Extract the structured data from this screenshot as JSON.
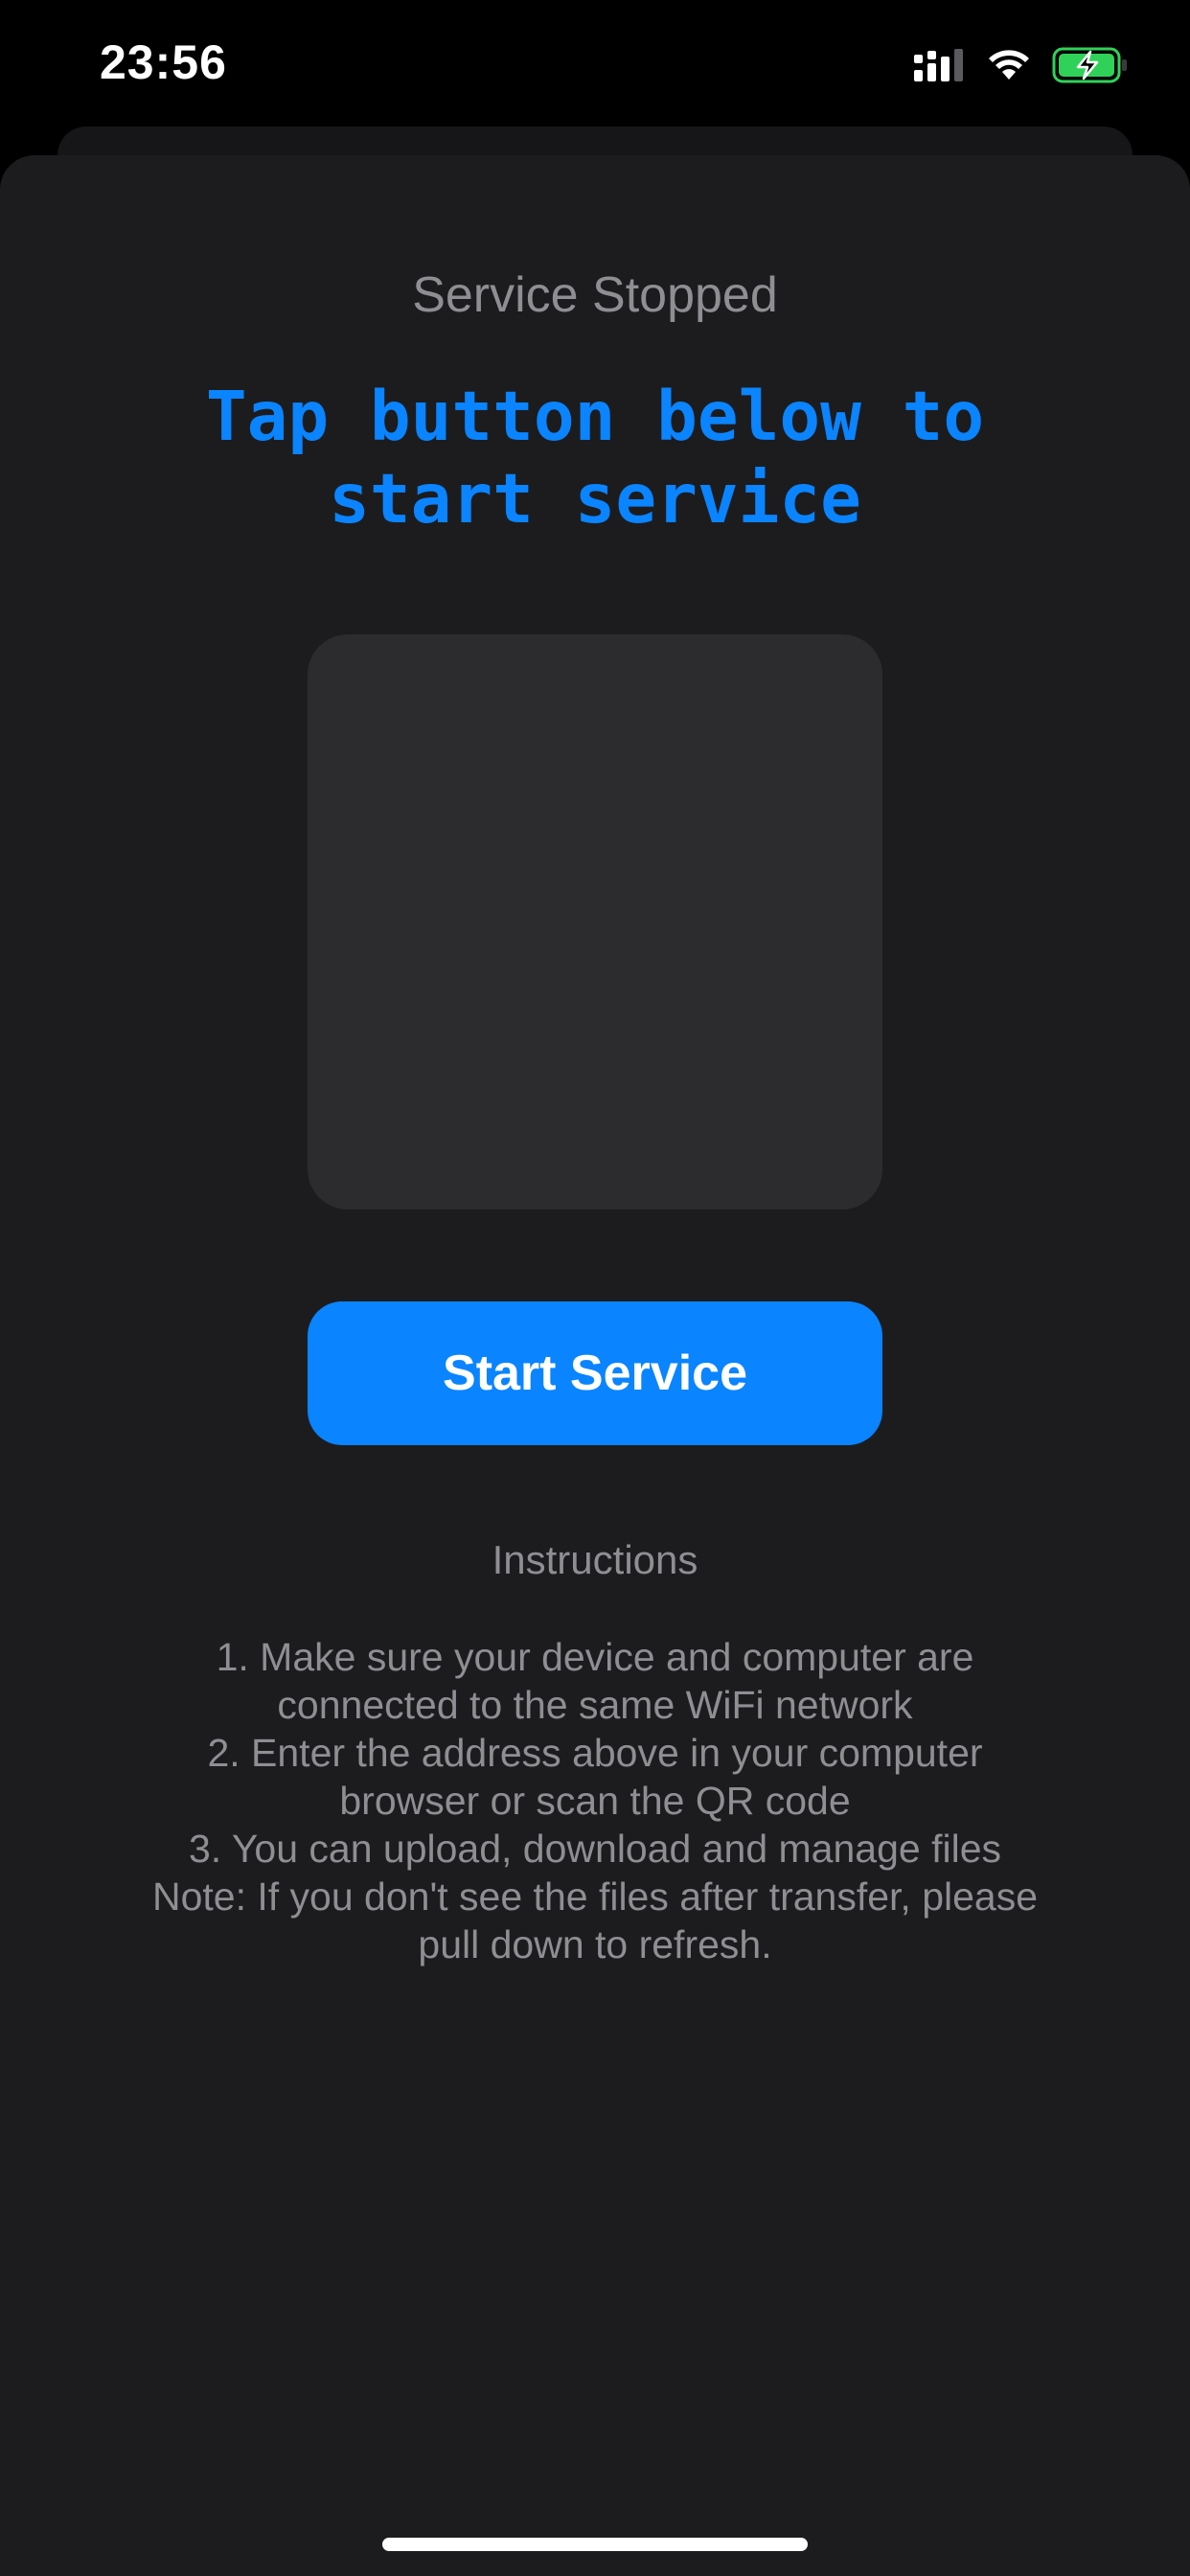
{
  "status_bar": {
    "time": "23:56",
    "icons": [
      "cellular-signal-icon",
      "wifi-icon",
      "battery-charging-icon"
    ],
    "battery_color": "#30d158"
  },
  "main": {
    "status_label": "Service Stopped",
    "headline_line1": "Tap button below to",
    "headline_line2": "start service",
    "start_button_label": "Start Service",
    "accent_color": "#0a84ff"
  },
  "instructions": {
    "title": "Instructions",
    "lines": [
      "1. Make sure your device and computer are",
      "connected to the same WiFi network",
      "2. Enter the address above in your computer",
      "browser or scan the QR code",
      "3. You can upload, download and manage files",
      "Note: If you don't see the files after transfer, please",
      "pull down to refresh."
    ]
  }
}
